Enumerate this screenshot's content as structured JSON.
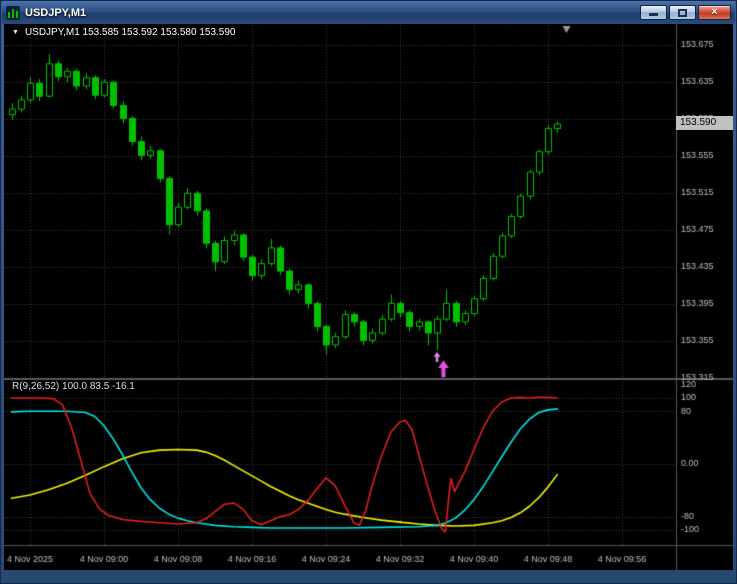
{
  "window": {
    "title": "USDJPY,M1",
    "icons": {
      "close": "×"
    }
  },
  "quote_line": {
    "icon": "▼",
    "text": "USDJPY,M1 153.585 153.592 153.580 153.590"
  },
  "indicator_label": "R(9,26,52) 100.0 83.5 -16.1",
  "price_tag": "153.590",
  "colors": {
    "background": "#000000",
    "candle": "#00C000",
    "bull_fill": "#000000",
    "grid": "#3F3F3F",
    "separator": "#5A5A5A",
    "axis_text": "#BEBEBE",
    "red_line": "#E02020",
    "cyan_line": "#00E5E5",
    "yellow_line": "#F2F200",
    "arrow_small": "#EE82EE",
    "arrow_large": "#E24DE2",
    "shift_marker": "#9A9A9A",
    "price_tag_bg": "#C0C0C0"
  },
  "chart_data": [
    {
      "type": "candlestick",
      "symbol": "USDJPY",
      "timeframe": "M1",
      "title": "USDJPY,M1",
      "last_price": 153.59,
      "last_ohlc": {
        "open": "153.585",
        "high": "153.592",
        "low": "153.580",
        "close": "153.590"
      },
      "y_ticks": [
        153.675,
        153.635,
        153.595,
        153.555,
        153.515,
        153.475,
        153.435,
        153.395,
        153.355,
        153.315
      ],
      "x_tick_labels": [
        "4 Nov 2025",
        "4 Nov 09:00",
        "4 Nov 09:08",
        "4 Nov 09:16",
        "4 Nov 09:24",
        "4 Nov 09:32",
        "4 Nov 09:40",
        "4 Nov 09:48",
        "4 Nov 09:56"
      ],
      "grid": true,
      "shift_marker_index": 60,
      "arrows": [
        {
          "index": 46,
          "price": 153.343,
          "style": "small"
        },
        {
          "index": 46.7,
          "price": 153.334,
          "style": "large"
        }
      ],
      "ohlc": [
        [
          153.6,
          153.612,
          153.594,
          153.606
        ],
        [
          153.606,
          153.62,
          153.602,
          153.616
        ],
        [
          153.616,
          153.64,
          153.612,
          153.634
        ],
        [
          153.634,
          153.638,
          153.614,
          153.62
        ],
        [
          153.62,
          153.665,
          153.618,
          153.655
        ],
        [
          153.655,
          153.658,
          153.636,
          153.641
        ],
        [
          153.641,
          153.65,
          153.634,
          153.647
        ],
        [
          153.647,
          153.649,
          153.626,
          153.631
        ],
        [
          153.631,
          153.644,
          153.627,
          153.64
        ],
        [
          153.64,
          153.642,
          153.616,
          153.621
        ],
        [
          153.621,
          153.638,
          153.618,
          153.635
        ],
        [
          153.635,
          153.636,
          153.606,
          153.61
        ],
        [
          153.61,
          153.614,
          153.59,
          153.596
        ],
        [
          153.596,
          153.598,
          153.566,
          153.571
        ],
        [
          153.571,
          153.576,
          153.55,
          153.556
        ],
        [
          153.556,
          153.566,
          153.552,
          153.561
        ],
        [
          153.561,
          153.562,
          153.526,
          153.531
        ],
        [
          153.531,
          153.533,
          153.47,
          153.481
        ],
        [
          153.481,
          153.504,
          153.478,
          153.5
        ],
        [
          153.5,
          153.52,
          153.497,
          153.515
        ],
        [
          153.515,
          153.517,
          153.49,
          153.496
        ],
        [
          153.496,
          153.498,
          153.455,
          153.461
        ],
        [
          153.461,
          153.463,
          153.43,
          153.441
        ],
        [
          153.441,
          153.468,
          153.438,
          153.464
        ],
        [
          153.464,
          153.474,
          153.458,
          153.47
        ],
        [
          153.47,
          153.471,
          153.441,
          153.446
        ],
        [
          153.446,
          153.448,
          153.42,
          153.426
        ],
        [
          153.426,
          153.443,
          153.422,
          153.439
        ],
        [
          153.439,
          153.465,
          153.436,
          153.456
        ],
        [
          153.456,
          153.458,
          153.426,
          153.431
        ],
        [
          153.431,
          153.433,
          153.405,
          153.411
        ],
        [
          153.411,
          153.42,
          153.406,
          153.416
        ],
        [
          153.416,
          153.417,
          153.39,
          153.396
        ],
        [
          153.396,
          153.398,
          153.365,
          153.371
        ],
        [
          153.371,
          153.373,
          153.34,
          153.351
        ],
        [
          153.351,
          153.364,
          153.347,
          153.36
        ],
        [
          153.36,
          153.388,
          153.357,
          153.384
        ],
        [
          153.384,
          153.386,
          153.37,
          153.376
        ],
        [
          153.376,
          153.378,
          153.35,
          153.356
        ],
        [
          153.356,
          153.368,
          153.352,
          153.364
        ],
        [
          153.364,
          153.383,
          153.361,
          153.379
        ],
        [
          153.379,
          153.405,
          153.376,
          153.396
        ],
        [
          153.396,
          153.398,
          153.38,
          153.386
        ],
        [
          153.386,
          153.388,
          153.365,
          153.371
        ],
        [
          153.371,
          153.379,
          153.366,
          153.376
        ],
        [
          153.376,
          153.377,
          153.35,
          153.364
        ],
        [
          153.364,
          153.382,
          153.345,
          153.379
        ],
        [
          153.379,
          153.41,
          153.376,
          153.396
        ],
        [
          153.396,
          153.398,
          153.37,
          153.376
        ],
        [
          153.376,
          153.388,
          153.372,
          153.385
        ],
        [
          153.385,
          153.404,
          153.382,
          153.401
        ],
        [
          153.401,
          153.426,
          153.398,
          153.423
        ],
        [
          153.423,
          153.45,
          153.42,
          153.447
        ],
        [
          153.447,
          153.472,
          153.444,
          153.469
        ],
        [
          153.469,
          153.492,
          153.466,
          153.49
        ],
        [
          153.49,
          153.514,
          153.487,
          153.512
        ],
        [
          153.512,
          153.54,
          153.508,
          153.538
        ],
        [
          153.538,
          153.562,
          153.534,
          153.56
        ],
        [
          153.56,
          153.588,
          153.556,
          153.585
        ],
        [
          153.585,
          153.592,
          153.58,
          153.59
        ]
      ]
    },
    {
      "type": "line",
      "name": "R(9,26,52)",
      "current_values": [
        100.0,
        83.5,
        -16.1
      ],
      "label": "R(9,26,52) 100.0 83.5 -16.1",
      "ylim": [
        -122,
        122
      ],
      "levels": [
        100,
        80,
        0,
        -80,
        -100
      ],
      "y_ticks": [
        120,
        100,
        80,
        0,
        -80,
        -100
      ],
      "y_tick_labels": [
        "120",
        "100",
        "80",
        "0.00",
        "-80",
        "-100"
      ],
      "series": [
        {
          "name": "fast-red",
          "color_key": "red_line",
          "points": [
            [
              0,
              100
            ],
            [
              3,
              100
            ],
            [
              4.5,
              99
            ],
            [
              5.5,
              90
            ],
            [
              6.5,
              55
            ],
            [
              7.5,
              5
            ],
            [
              8.5,
              -45
            ],
            [
              9.5,
              -68
            ],
            [
              10.5,
              -78
            ],
            [
              12,
              -84
            ],
            [
              14,
              -87
            ],
            [
              16,
              -89
            ],
            [
              18,
              -91
            ],
            [
              20,
              -89
            ],
            [
              21,
              -83
            ],
            [
              22,
              -72
            ],
            [
              23,
              -61
            ],
            [
              24,
              -59
            ],
            [
              25,
              -68
            ],
            [
              26,
              -86
            ],
            [
              27,
              -92
            ],
            [
              28,
              -86
            ],
            [
              29,
              -80
            ],
            [
              30,
              -77
            ],
            [
              31,
              -69
            ],
            [
              32,
              -56
            ],
            [
              33,
              -38
            ],
            [
              34,
              -21
            ],
            [
              35,
              -33
            ],
            [
              36,
              -62
            ],
            [
              37,
              -89
            ],
            [
              37.6,
              -93
            ],
            [
              38.3,
              -70
            ],
            [
              39,
              -32
            ],
            [
              40,
              12
            ],
            [
              41,
              48
            ],
            [
              42,
              64
            ],
            [
              42.6,
              66
            ],
            [
              43.3,
              52
            ],
            [
              44,
              16
            ],
            [
              45,
              -35
            ],
            [
              45.8,
              -72
            ],
            [
              46.5,
              -98
            ],
            [
              46.9,
              -103
            ],
            [
              47.2,
              -60
            ],
            [
              47.5,
              -22
            ],
            [
              47.9,
              -42
            ],
            [
              48.4,
              -28
            ],
            [
              49,
              -12
            ],
            [
              50,
              22
            ],
            [
              51,
              55
            ],
            [
              52,
              80
            ],
            [
              53,
              94
            ],
            [
              54,
              100
            ],
            [
              55,
              101
            ],
            [
              56,
              100
            ],
            [
              57,
              101
            ],
            [
              58,
              101
            ],
            [
              59,
              100
            ]
          ]
        },
        {
          "name": "slow-cyan",
          "color_key": "cyan_line",
          "points": [
            [
              0,
              79
            ],
            [
              2,
              80
            ],
            [
              4,
              80
            ],
            [
              6,
              80
            ],
            [
              8,
              78
            ],
            [
              9,
              72
            ],
            [
              10,
              58
            ],
            [
              11,
              38
            ],
            [
              12,
              14
            ],
            [
              13,
              -12
            ],
            [
              14,
              -36
            ],
            [
              15,
              -54
            ],
            [
              16,
              -67
            ],
            [
              17,
              -76
            ],
            [
              18,
              -82
            ],
            [
              19,
              -86
            ],
            [
              20,
              -89
            ],
            [
              21,
              -91
            ],
            [
              22,
              -93
            ],
            [
              24,
              -95
            ],
            [
              26,
              -96
            ],
            [
              28,
              -97
            ],
            [
              32,
              -97
            ],
            [
              36,
              -97
            ],
            [
              40,
              -96
            ],
            [
              44,
              -95
            ],
            [
              45,
              -94
            ],
            [
              46,
              -93
            ],
            [
              47,
              -89
            ],
            [
              48,
              -82
            ],
            [
              49,
              -70
            ],
            [
              50,
              -54
            ],
            [
              51,
              -34
            ],
            [
              52,
              -12
            ],
            [
              53,
              11
            ],
            [
              54,
              33
            ],
            [
              55,
              53
            ],
            [
              56,
              68
            ],
            [
              57,
              78
            ],
            [
              58,
              82
            ],
            [
              59,
              83.5
            ]
          ]
        },
        {
          "name": "trend-yellow",
          "color_key": "yellow_line",
          "points": [
            [
              0,
              -52
            ],
            [
              2,
              -47
            ],
            [
              4,
              -39
            ],
            [
              6,
              -29
            ],
            [
              8,
              -17
            ],
            [
              10,
              -4
            ],
            [
              12,
              8
            ],
            [
              14,
              17
            ],
            [
              16,
              21
            ],
            [
              18,
              22
            ],
            [
              20,
              21
            ],
            [
              21,
              18
            ],
            [
              22,
              13
            ],
            [
              23,
              6
            ],
            [
              24,
              -2
            ],
            [
              25,
              -10
            ],
            [
              26,
              -18
            ],
            [
              27,
              -26
            ],
            [
              28,
              -34
            ],
            [
              29,
              -41
            ],
            [
              30,
              -48
            ],
            [
              31,
              -54
            ],
            [
              32,
              -59
            ],
            [
              33,
              -64
            ],
            [
              34,
              -69
            ],
            [
              35,
              -73
            ],
            [
              36,
              -76
            ],
            [
              38,
              -81
            ],
            [
              40,
              -85
            ],
            [
              42,
              -88
            ],
            [
              44,
              -91
            ],
            [
              46,
              -93
            ],
            [
              48,
              -94
            ],
            [
              50,
              -93
            ],
            [
              52,
              -89
            ],
            [
              53,
              -86
            ],
            [
              54,
              -81
            ],
            [
              55,
              -74
            ],
            [
              56,
              -64
            ],
            [
              57,
              -51
            ],
            [
              58,
              -35
            ],
            [
              59,
              -16.1
            ]
          ]
        }
      ]
    }
  ]
}
